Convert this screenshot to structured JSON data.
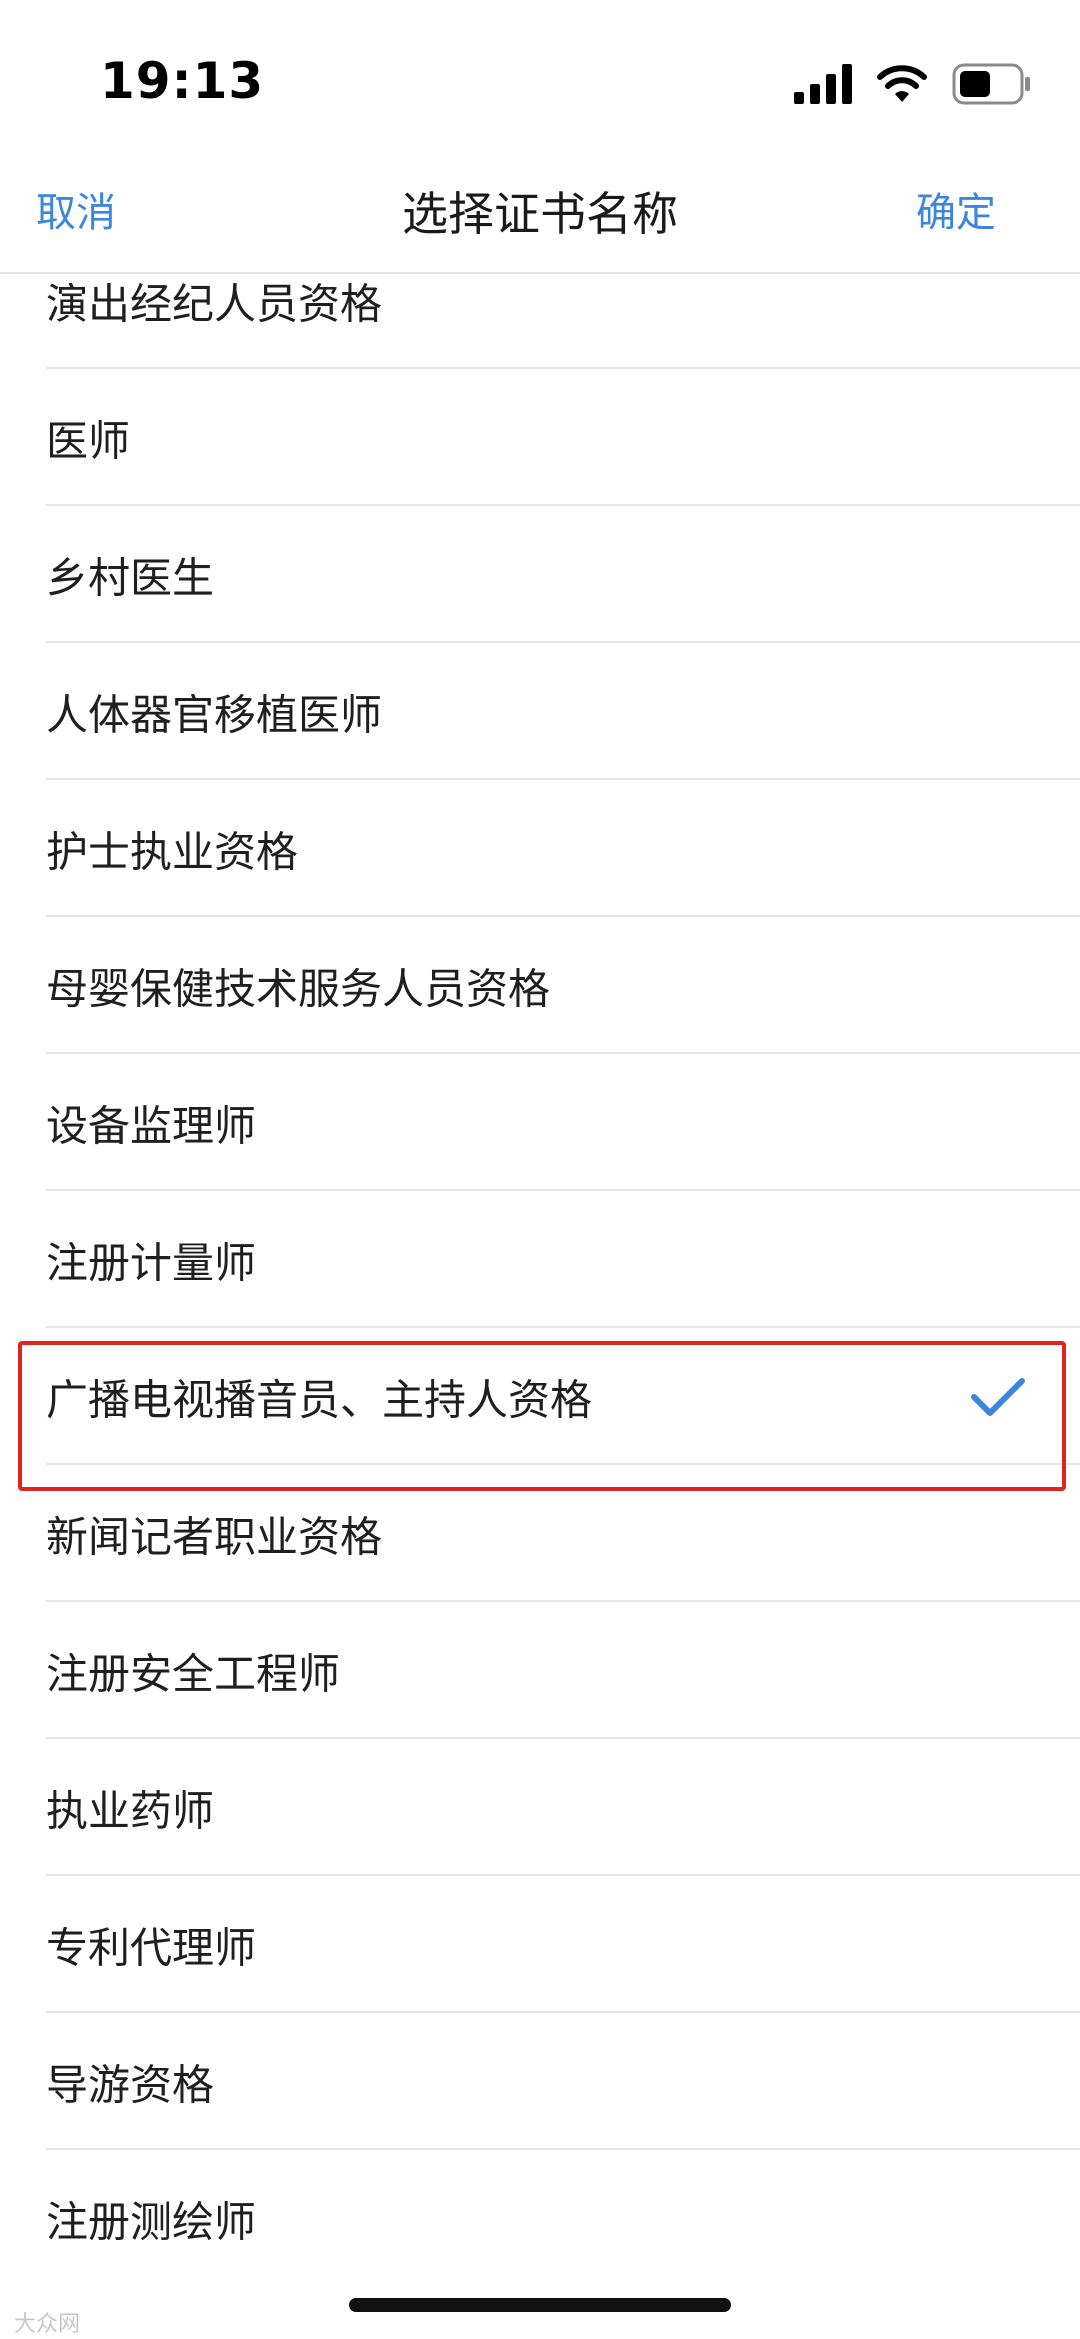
{
  "status_bar": {
    "time": "19:13",
    "icons": [
      "signal-icon",
      "wifi-icon",
      "battery-icon"
    ]
  },
  "nav": {
    "cancel_label": "取消",
    "title": "选择证书名称",
    "confirm_label": "确定"
  },
  "accent_color": "#3d86db",
  "highlight_color": "#e2241f",
  "list": {
    "items": [
      {
        "label": "演出经纪人员资格",
        "selected": false
      },
      {
        "label": "医师",
        "selected": false
      },
      {
        "label": "乡村医生",
        "selected": false
      },
      {
        "label": "人体器官移植医师",
        "selected": false
      },
      {
        "label": "护士执业资格",
        "selected": false
      },
      {
        "label": "母婴保健技术服务人员资格",
        "selected": false
      },
      {
        "label": "设备监理师",
        "selected": false
      },
      {
        "label": "注册计量师",
        "selected": false
      },
      {
        "label": "广播电视播音员、主持人资格",
        "selected": true
      },
      {
        "label": "新闻记者职业资格",
        "selected": false
      },
      {
        "label": "注册安全工程师",
        "selected": false
      },
      {
        "label": "执业药师",
        "selected": false
      },
      {
        "label": "专利代理师",
        "selected": false
      },
      {
        "label": "导游资格",
        "selected": false
      },
      {
        "label": "注册测绘师",
        "selected": false
      }
    ]
  },
  "watermark": "大众网"
}
